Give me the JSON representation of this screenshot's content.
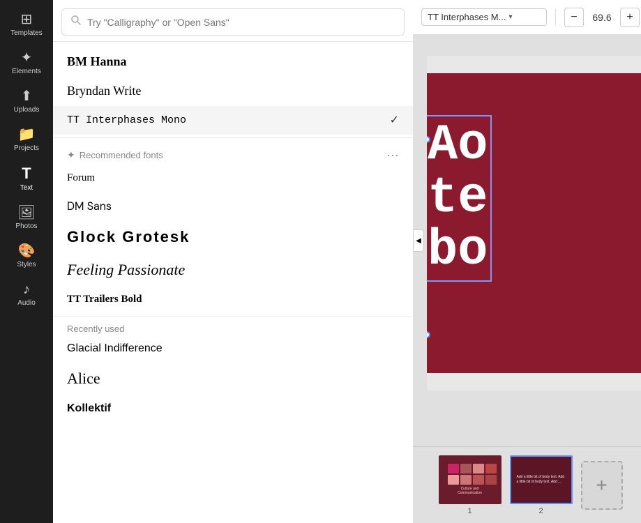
{
  "sidebar": {
    "items": [
      {
        "id": "templates",
        "label": "Templates",
        "icon": "⊞",
        "active": false
      },
      {
        "id": "elements",
        "label": "Elements",
        "icon": "✦",
        "active": false
      },
      {
        "id": "uploads",
        "label": "Uploads",
        "icon": "⬆",
        "active": false
      },
      {
        "id": "projects",
        "label": "Projects",
        "icon": "📁",
        "active": false
      },
      {
        "id": "text",
        "label": "Text",
        "icon": "T",
        "active": true
      },
      {
        "id": "photos",
        "label": "Photos",
        "icon": "🖼",
        "active": false
      },
      {
        "id": "styles",
        "label": "Styles",
        "icon": "🎨",
        "active": false
      },
      {
        "id": "audio",
        "label": "Audio",
        "icon": "♪",
        "active": false
      }
    ]
  },
  "font_panel": {
    "search": {
      "placeholder": "Try \"Calligraphy\" or \"Open Sans\""
    },
    "current_font": "TT Interphases Mono",
    "fonts_top": [
      {
        "name": "BM Hanna",
        "style": "bm-hanna",
        "selected": false
      },
      {
        "name": "Bryndan Write",
        "style": "bryndan",
        "selected": false
      },
      {
        "name": "TT Interphases Mono",
        "style": "tt-inter",
        "selected": true
      }
    ],
    "recommended_label": "Recommended fonts",
    "recommended_more": "···",
    "fonts_recommended": [
      {
        "name": "Forum",
        "style": "forum"
      },
      {
        "name": "DM Sans",
        "style": "dm-sans"
      },
      {
        "name": "Glock  Grotesk",
        "style": "glock"
      },
      {
        "name": "Feeling Passionate",
        "style": "feeling"
      },
      {
        "name": "TT Trailers Bold",
        "style": "tt-trailers"
      }
    ],
    "recently_used_label": "Recently used",
    "fonts_recent": [
      {
        "name": "Glacial Indifference",
        "style": "glacial"
      },
      {
        "name": "Alice",
        "style": "alice"
      },
      {
        "name": "Kollektif",
        "style": "kollektif"
      }
    ]
  },
  "toolbar": {
    "font_name": "TT Interphases M...",
    "font_size": "69.6",
    "decrease_label": "−",
    "increase_label": "+"
  },
  "canvas": {
    "slide_text": "Ao\nte\nbo"
  },
  "thumbnails": [
    {
      "number": "1",
      "active": false
    },
    {
      "number": "2",
      "active": true
    }
  ],
  "add_page_label": "+"
}
